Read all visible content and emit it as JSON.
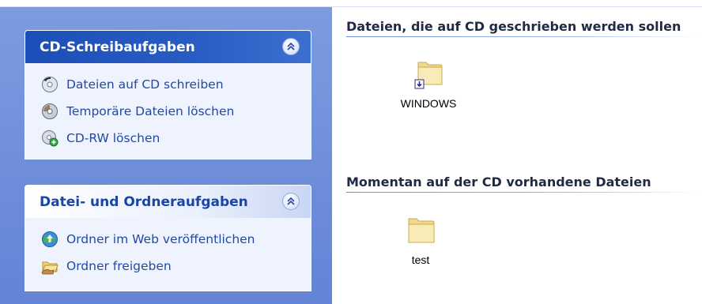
{
  "colors": {
    "pane_background": "#6b8ad8",
    "panel_header_dark": "#1b4eb7",
    "task_link": "#2149a6"
  },
  "task_pane": {
    "panels": [
      {
        "title": "CD-Schreibaufgaben",
        "collapse_icon": "chevron-up-double-icon",
        "tasks": [
          {
            "label": "Dateien auf CD schreiben",
            "icon": "cd-write-icon"
          },
          {
            "label": "Temporäre Dateien löschen",
            "icon": "cd-delete-temp-icon"
          },
          {
            "label": "CD-RW löschen",
            "icon": "cdrw-erase-icon"
          }
        ]
      },
      {
        "title": "Datei- und Ordneraufgaben",
        "collapse_icon": "chevron-up-double-icon",
        "tasks": [
          {
            "label": "Ordner im Web veröffentlichen",
            "icon": "web-publish-icon"
          },
          {
            "label": "Ordner freigeben",
            "icon": "share-folder-icon"
          }
        ]
      }
    ]
  },
  "content": {
    "groups": [
      {
        "title": "Dateien, die auf CD geschrieben werden sollen",
        "items": [
          {
            "name": "WINDOWS",
            "icon": "folder-pending-icon"
          }
        ]
      },
      {
        "title": "Momentan auf der CD vorhandene Dateien",
        "items": [
          {
            "name": "test",
            "icon": "folder-icon"
          }
        ]
      }
    ]
  }
}
